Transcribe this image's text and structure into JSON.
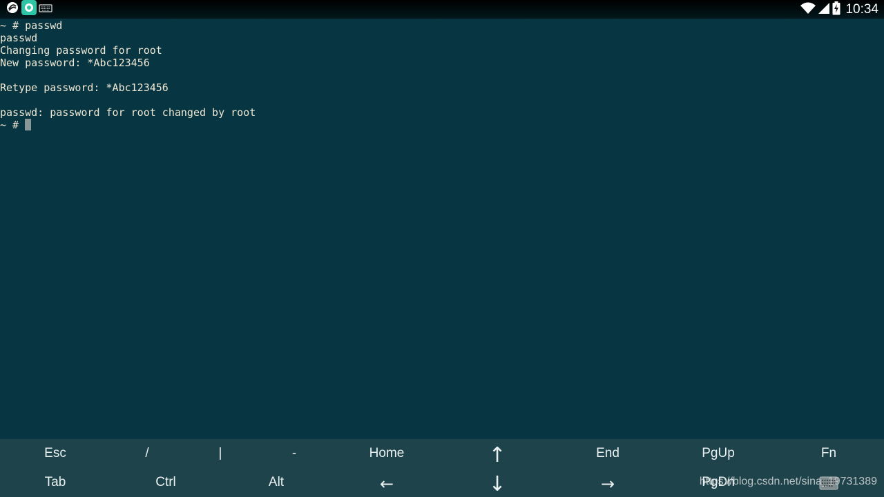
{
  "status_bar": {
    "time": "10:34",
    "left_icons": [
      "app-swirl-icon",
      "app-flower-icon",
      "keyboard-icon"
    ],
    "right_icons": [
      "wifi-icon",
      "cellular-signal-icon",
      "battery-charging-icon"
    ]
  },
  "terminal": {
    "lines": [
      "~ # passwd",
      "passwd",
      "Changing password for root",
      "New password: *Abc123456",
      "",
      "Retype password: *Abc123456",
      "",
      "passwd: password for root changed by root"
    ],
    "prompt": "~ # "
  },
  "extra_keys": {
    "row1": [
      "Esc",
      "/",
      "|",
      "-",
      "Home",
      "↑",
      "End",
      "PgUp",
      "Fn"
    ],
    "row2": [
      "Tab",
      "Ctrl",
      "Alt",
      "←",
      "↓",
      "→",
      "PgDn"
    ]
  },
  "watermark": "https://blog.csdn.net/sina_19731389",
  "colors": {
    "terminal_bg": "#073642",
    "terminal_fg": "#eee8d5",
    "extra_keys_bg": "#1f434b"
  }
}
